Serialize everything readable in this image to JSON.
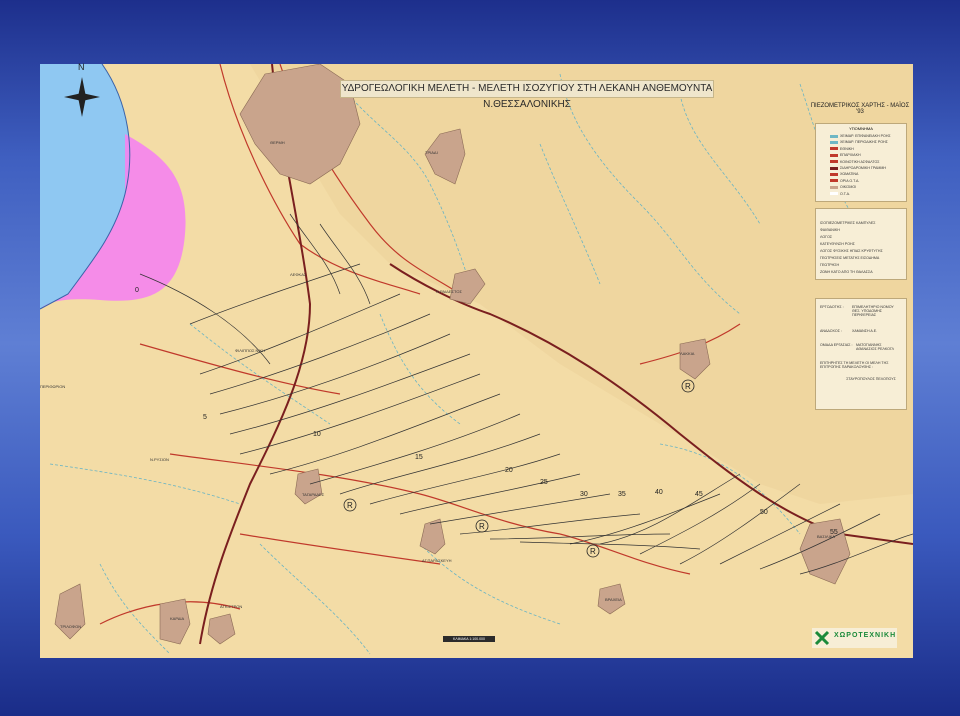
{
  "title": "ΥΔΡΟΓΕΩΛΟΓΙΚΗ ΜΕΛΕΤΗ - ΜΕΛΕΤΗ ΙΣΟΖΥΓΙΟΥ ΣΤΗ ΛΕΚΑΝΗ ΑΝΘΕΜΟΥΝΤΑ Ν.ΘΕΣΣΑΛΟΝΙΚΗΣ",
  "map_subtitle": "ΠΙΕΖΟΜΕΤΡΙΚΟΣ ΧΑΡΤΗΣ - ΜΑΪΟΣ '93",
  "north_label": "N",
  "scale_text": "ΚΛΙΜΑΚΑ 1:100.000",
  "legend": {
    "heading": "ΥΠΟΜΝΗΜΑ",
    "items": [
      {
        "label": "ΧΕΙΜΑΡ. ΕΠΙΦΑΝΕΙΑΚΗ ΡΟΗΣ",
        "color": "#6fb7c4"
      },
      {
        "label": "ΧΕΙΜΑΡ. ΠΕΡΙΟΔΙΚΗΣ ΡΟΗΣ",
        "color": "#6fb7c4"
      },
      {
        "label": "ΕΘΝΙΚΗ",
        "color": "#c0392b"
      },
      {
        "label": "ΕΠΑΡΧΙΑΚΗ",
        "color": "#c0392b"
      },
      {
        "label": "ΚΟΙΝΟΤΙΚΗ ΑΣΦΑΛΤΟΣ",
        "color": "#c0392b"
      },
      {
        "label": "ΣΙΔΗΡΟΔΡΟΜΙΚΗ ΓΡΑΜΜΗ",
        "color": "#7a1f1f"
      },
      {
        "label": "ΧΩΜΑΤΙΝΑ",
        "color": "#c0392b"
      },
      {
        "label": "ΟΡΙΑ Ο.Τ.Α.",
        "color": "#c0392b"
      },
      {
        "label": "ΟΙΚΙΣΜΟΙ",
        "color": "#c9a48c"
      },
      {
        "label": "Ο.Τ.Α.",
        "color": "#ffffff"
      }
    ]
  },
  "legend2": {
    "items": [
      {
        "label": "ΙΣΟΠΙΕΖΟΜΕΤΡΙΚΕΣ ΚΑΜΠΥΛΕΣ"
      },
      {
        "label": "ΦΑΙΘΑΝΙΚΗ"
      },
      {
        "label": "ΛΟΓΟΣ"
      },
      {
        "label": "ΚΑΤΕΥΘΥΝΣΗ ΡΟΗΣ"
      },
      {
        "label": "ΛΟΓΟΣ ΦΥΣΙΚΗΣ ΗΠΙΑΣ ΚΡΥΦΤΥΓΗΣ"
      },
      {
        "label": "ΓΕΩΤΡΗΣΕΙΣ ΜΕΤΑΤΗΣ ΕΙΣΟΔΗΜΑ"
      },
      {
        "label": "ΓΕΩΤΡΗΣΗ"
      },
      {
        "label": "ΖΩΝΗ ΚΑΤΟ ΑΠΟ ΤΗ ΘΑΛΑΣΣΑ"
      }
    ]
  },
  "project": {
    "owner_label": "ΕΡΓΟΔΟΤΗΣ :",
    "owner_value": "ΕΠΙΜΕΛΗΤΗΡΙΟ ΝΟΜΟΥ ΘΕΣ. ΥΠΟΔΟΜΗΣ ΠΕΡΙΦΕΡΕΙΑΣ",
    "contractor_label": "ΑΝΑΔΟΧΟΣ :",
    "contractor_value": "ΧΑΜΑΝΣΗ Α.Ε.",
    "team_label": "ΟΜΑΔΑ ΕΡΓΑΣΙΑΣ :",
    "team_value": "ΜΑΤΟΓΙΑΝΝΗΣ ΑΘΑΝΑΣΙΟΣ ΡΕΛΚΟΓΛ",
    "supervision": "ΕΠΙΤΗΡΗΤΕΣ ΤΗ ΜΕΛΕΤΗ ΟΙ ΜΕΛΗ ΤΗΣ ΕΠΙΤΡΟΠΗΣ ΠΑΡΑΚΟΛΟΥΘΗΣ :",
    "signatures": "ΣΤΑΥΡΟΠΟΥΛΟΣ ΠΕΛΟΠΟΥΣ"
  },
  "company": {
    "name": "ΧΩΡΟΤΕΧΝΙΚΗ"
  },
  "place_labels": [
    "ΘΕΡΜΗ",
    "ΤΡΙΑΔΙ",
    "Ν.ΡΑΙΔΕΣΤΟΣ",
    "ΦΙΛΙΠΠΟΣ ΝΙΚΗ",
    "ΛΑΚΚΙΑ",
    "Ν.ΡΥΣΙΟΝ",
    "ΤΑΓΑΡΑΔΕΣ",
    "ΑΓ.ΠΑΡΑΣΚΕΥΗ",
    "ΒΑΣΙΛΙΚΑ",
    "ΤΡΙΛΟΦΟΝ",
    "ΚΑΡΔΙΑ",
    "ΑΓΚΙΣΤΡΟΝ",
    "ΒΡΑΧΕΙΑ",
    "ΠΕΡΙΘΩΡΙΟΝ",
    "ΛΕΦΚΑΣ"
  ],
  "contour_labels": [
    "0",
    "5",
    "10",
    "15",
    "20",
    "25",
    "30",
    "35",
    "40",
    "45",
    "50",
    "55"
  ],
  "colors": {
    "sea": "#8fc8f2",
    "salinization": "#f583f0",
    "plain": "#f3dca6",
    "settlement": "#c9a48c",
    "contour": "#333333",
    "road": "#c0392b",
    "stream": "#69b4c4"
  }
}
